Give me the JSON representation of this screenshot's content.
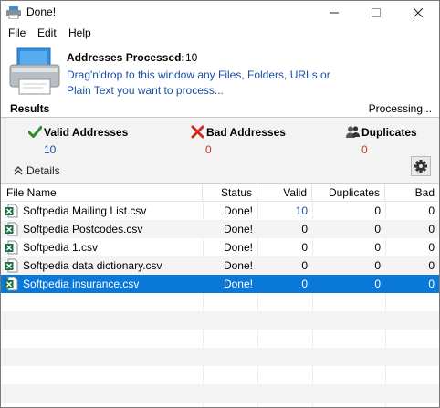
{
  "window": {
    "title": "Done!"
  },
  "menu": [
    "File",
    "Edit",
    "Help"
  ],
  "header": {
    "processed_label": "Addresses Processed:",
    "processed_count": "10",
    "instructions": "Drag'n'drop to this window any Files, Folders, URLs or Plain Text you want to process..."
  },
  "results": {
    "label": "Results",
    "status": "Processing...",
    "valid_label": "Valid Addresses",
    "valid_count": "10",
    "bad_label": "Bad Addresses",
    "bad_count": "0",
    "dup_label": "Duplicates",
    "dup_count": "0",
    "details_label": "Details"
  },
  "table": {
    "columns": [
      "File Name",
      "Status",
      "Valid",
      "Duplicates",
      "Bad"
    ],
    "rows": [
      {
        "name": "Softpedia Mailing List.csv",
        "status": "Done!",
        "valid": "10",
        "duplicates": "0",
        "bad": "0"
      },
      {
        "name": "Softpedia Postcodes.csv",
        "status": "Done!",
        "valid": "0",
        "duplicates": "0",
        "bad": "0"
      },
      {
        "name": "Softpedia 1.csv",
        "status": "Done!",
        "valid": "0",
        "duplicates": "0",
        "bad": "0"
      },
      {
        "name": "Softpedia data dictionary.csv",
        "status": "Done!",
        "valid": "0",
        "duplicates": "0",
        "bad": "0"
      },
      {
        "name": "Softpedia insurance.csv",
        "status": "Done!",
        "valid": "0",
        "duplicates": "0",
        "bad": "0"
      }
    ],
    "selected_row": 4
  },
  "colors": {
    "accent_blue": "#1a4fa3",
    "bad_red": "#c0392b",
    "selection": "#0a78d7",
    "excel_green": "#1e7145"
  },
  "icons": {
    "app": "printer-icon",
    "scanner": "scanner-icon",
    "valid": "checkmark-icon",
    "bad": "x-icon",
    "duplicates": "people-icon",
    "details": "chevron-up-double-icon",
    "settings": "gear-icon",
    "file": "excel-file-icon"
  }
}
